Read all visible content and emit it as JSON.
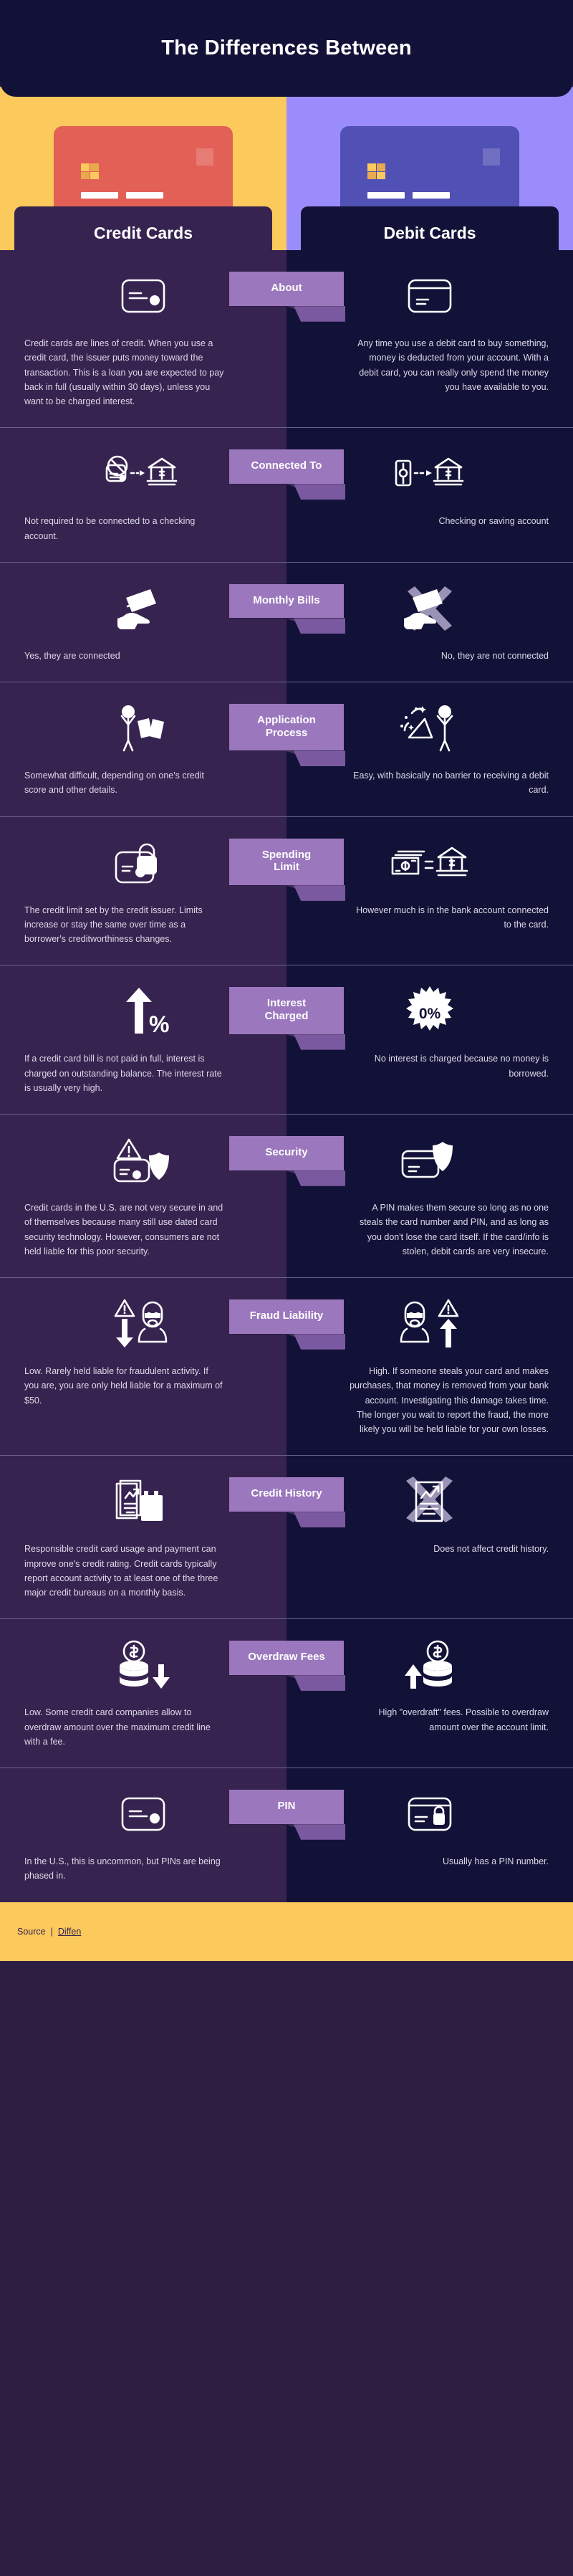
{
  "header": {
    "title": "The Differences Between"
  },
  "hero": {
    "left_bg": "#fbc95c",
    "right_bg": "#9a8cfb",
    "left_card_color": "#e26056",
    "right_card_color": "#5150b4"
  },
  "columns": {
    "left_title": "Credit Cards",
    "right_title": "Debit Cards"
  },
  "colors": {
    "header_bg": "#121238",
    "left_column_bg": "#372350",
    "right_column_bg": "#121238",
    "badge_bg": "#9b77bd",
    "badge_fold": "#7a59a0",
    "accent_yellow": "#fbc95c",
    "accent_purple": "#9a8cfb",
    "body_text": "#ded9e8",
    "divider": "#6a6090"
  },
  "rows": [
    {
      "badge": "About",
      "left_icon": "credit-card-icon",
      "right_icon": "debit-card-stripe-icon",
      "left": "Credit cards are lines of credit. When you use a credit card, the issuer puts money toward the transaction. This is a loan you are expected to pay back in full (usually within 30 days), unless you want to be charged interest.",
      "right": "Any time you use a debit card to buy something, money is deducted from your account. With a debit card, you can really only spend the money you have available to you."
    },
    {
      "badge": "Connected To",
      "left_icon": "card-not-connected-bank-icon",
      "right_icon": "card-connected-bank-icon",
      "left": "Not required to be connected to a checking account.",
      "right": "Checking or saving account"
    },
    {
      "badge": "Monthly Bills",
      "left_icon": "cash-in-hand-icon",
      "right_icon": "cash-in-hand-crossed-icon",
      "left": "Yes, they are connected",
      "right": "No, they are not connected"
    },
    {
      "badge": "Application\nProcess",
      "badge_line1": "Application",
      "badge_line2": "Process",
      "left_icon": "person-with-forms-icon",
      "right_icon": "person-celebrating-icon",
      "left": "Somewhat difficult, depending on one's credit score and other details.",
      "right": "Easy, with basically no barrier to receiving a debit card."
    },
    {
      "badge_line1": "Spending",
      "badge_line2": "Limit",
      "left_icon": "card-with-lock-icon",
      "right_icon": "cash-equals-bank-icon",
      "left": "The credit limit set by the credit issuer. Limits increase or stay the same over time as a borrower's creditworthiness changes.",
      "right": "However much is in the bank account connected to the card."
    },
    {
      "badge_line1": "Interest",
      "badge_line2": "Charged",
      "left_icon": "arrow-up-percent-icon",
      "right_icon": "zero-percent-burst-icon",
      "left": "If a credit card bill is not paid in full, interest is charged on outstanding balance. The interest rate is usually very high.",
      "right": "No interest is charged because no money is borrowed."
    },
    {
      "badge": "Security",
      "left_icon": "card-warning-shield-icon",
      "right_icon": "card-shield-check-icon",
      "left": "Credit cards in the U.S. are not very secure in and of themselves because many still use dated card security technology. However, consumers are not held liable for this poor security.",
      "right": "A PIN makes them secure so long as no one steals the card number and PIN, and as long as you don't lose the card itself. If the card/info is stolen, debit cards are very insecure."
    },
    {
      "badge": "Fraud Liability",
      "left_icon": "thief-arrow-down-icon",
      "right_icon": "thief-arrow-up-icon",
      "left": "Low. Rarely held liable for fraudulent activity. If you are, you are only held liable for a maximum of $50.",
      "right": "High. If someone steals your card and makes purchases, that money is removed from your bank account. Investigating this damage takes time. The longer you wait to report the fraud, the more likely you will be held liable for your own losses."
    },
    {
      "badge": "Credit History",
      "left_icon": "report-calendar-icon",
      "right_icon": "report-crossed-icon",
      "left": "Responsible credit card usage and payment can improve one's credit rating. Credit cards typically report account activity to at least one of the three major credit bureaus on a monthly basis.",
      "right": "Does not affect credit history."
    },
    {
      "badge": "Overdraw Fees",
      "left_icon": "coins-arrow-down-icon",
      "right_icon": "coins-arrow-up-icon",
      "left": "Low. Some credit card companies allow to overdraw amount over the maximum credit line with a fee.",
      "right": "High \"overdraft\" fees. Possible to overdraw amount over the account limit."
    },
    {
      "badge": "PIN",
      "left_icon": "plain-card-icon",
      "right_icon": "card-with-padlock-icon",
      "left": "In the U.S., this is uncommon, but PINs are being phased in.",
      "right": "Usually has a PIN number."
    }
  ],
  "footer": {
    "label": "Source",
    "separator": "|",
    "link": "Diffen"
  }
}
